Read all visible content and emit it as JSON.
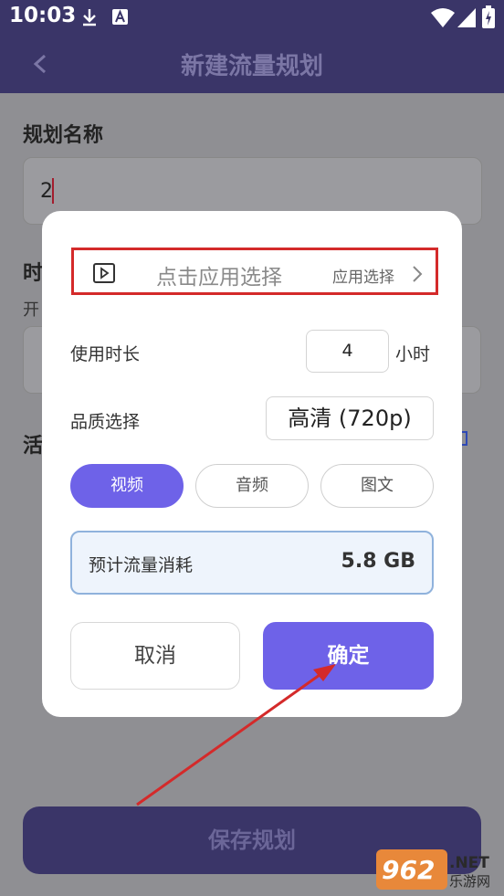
{
  "status_bar": {
    "time": "10:03"
  },
  "app_bar": {
    "title": "新建流量规划"
  },
  "form": {
    "plan_name_label": "规划名称",
    "plan_name_value": "2",
    "time_label_partial": "时",
    "start_label_partial": "开",
    "activity_label_partial": "活"
  },
  "save_button": {
    "label": "保存规划"
  },
  "dialog": {
    "app_picker": {
      "placeholder": "点击应用选择",
      "action_label": "应用选择"
    },
    "duration": {
      "label": "使用时长",
      "value": "4",
      "unit": "小时"
    },
    "quality": {
      "label": "品质选择",
      "value": "高清 (720p)"
    },
    "type_tabs": [
      {
        "label": "视频",
        "selected": true
      },
      {
        "label": "音频",
        "selected": false
      },
      {
        "label": "图文",
        "selected": false
      }
    ],
    "estimate": {
      "label": "预计流量消耗",
      "value": "5.8 GB"
    },
    "cancel_label": "取消",
    "confirm_label": "确定"
  },
  "watermark": {
    "text": "962.NET",
    "sub": "乐游网"
  },
  "colors": {
    "accent": "#6e62e8",
    "header": "#3a3568",
    "annotation": "#d42a2a"
  }
}
